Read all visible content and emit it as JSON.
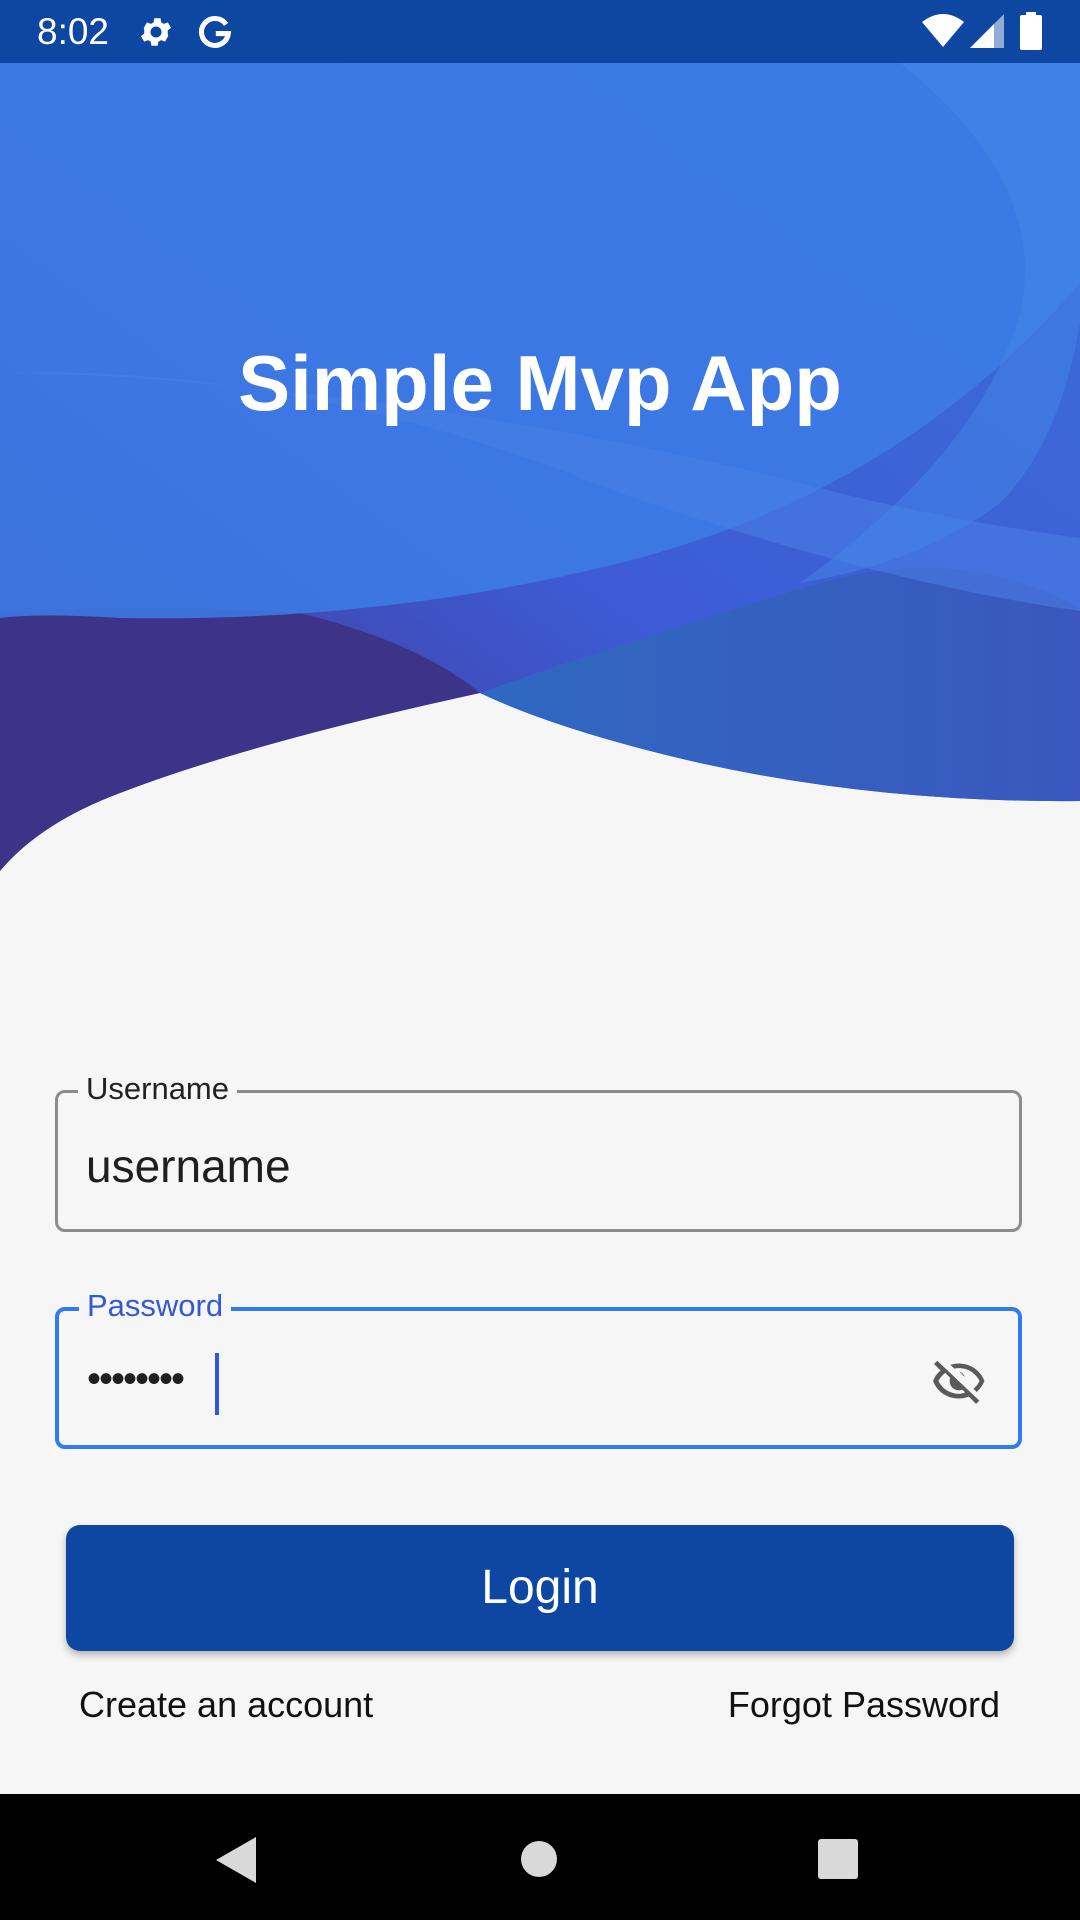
{
  "status_bar": {
    "time": "8:02",
    "icons": [
      "gear-icon",
      "google-icon",
      "wifi-icon",
      "cell-signal-icon",
      "battery-icon"
    ]
  },
  "header": {
    "title": "Simple Mvp App"
  },
  "form": {
    "username": {
      "label": "Username",
      "value": "username"
    },
    "password": {
      "label": "Password",
      "masked_value": "••••••••",
      "toggle_icon": "eye-off-icon"
    },
    "login_label": "Login",
    "create_account_label": "Create an account",
    "forgot_password_label": "Forgot Password"
  },
  "nav_bar": {
    "icons": [
      "back-icon",
      "home-icon",
      "recents-icon"
    ]
  },
  "colors": {
    "primary": "#0d47a1",
    "accent": "#2f7cee",
    "background": "#f6f6f7"
  }
}
